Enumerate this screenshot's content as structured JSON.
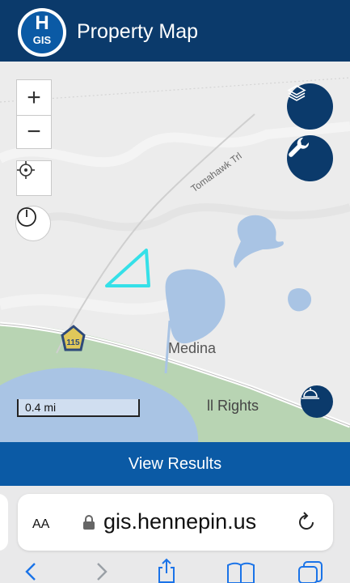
{
  "header": {
    "logo_letter": "H",
    "logo_text": "GIS",
    "title": "Property Map"
  },
  "map": {
    "road_label": "Tomahawk Trl",
    "place_label": "Medina",
    "attribution_fragment": "ll Rights",
    "route_shield": "115",
    "scale_label": "0.4 mi",
    "controls": {
      "zoom_in": "+",
      "zoom_out": "−"
    },
    "colors": {
      "selection_outline": "#35e0e8",
      "water": "#a9c4e4",
      "park": "#b8d4b3",
      "header": "#0b3a6b",
      "accent": "#0b5aa5"
    }
  },
  "results_bar": {
    "label": "View Results"
  },
  "browser": {
    "text_size_label": "AA",
    "url": "gis.hennepin.us"
  },
  "icons": {
    "layers": "layers-icon",
    "tools": "wrench-icon",
    "locate": "crosshair-icon",
    "measure": "stopwatch-icon",
    "basemap": "basemap-icon",
    "lock": "lock-icon",
    "reload": "reload-icon",
    "back": "chevron-left-icon",
    "forward": "chevron-right-icon",
    "share": "share-icon",
    "bookmarks": "book-icon",
    "tabs": "tabs-icon"
  }
}
